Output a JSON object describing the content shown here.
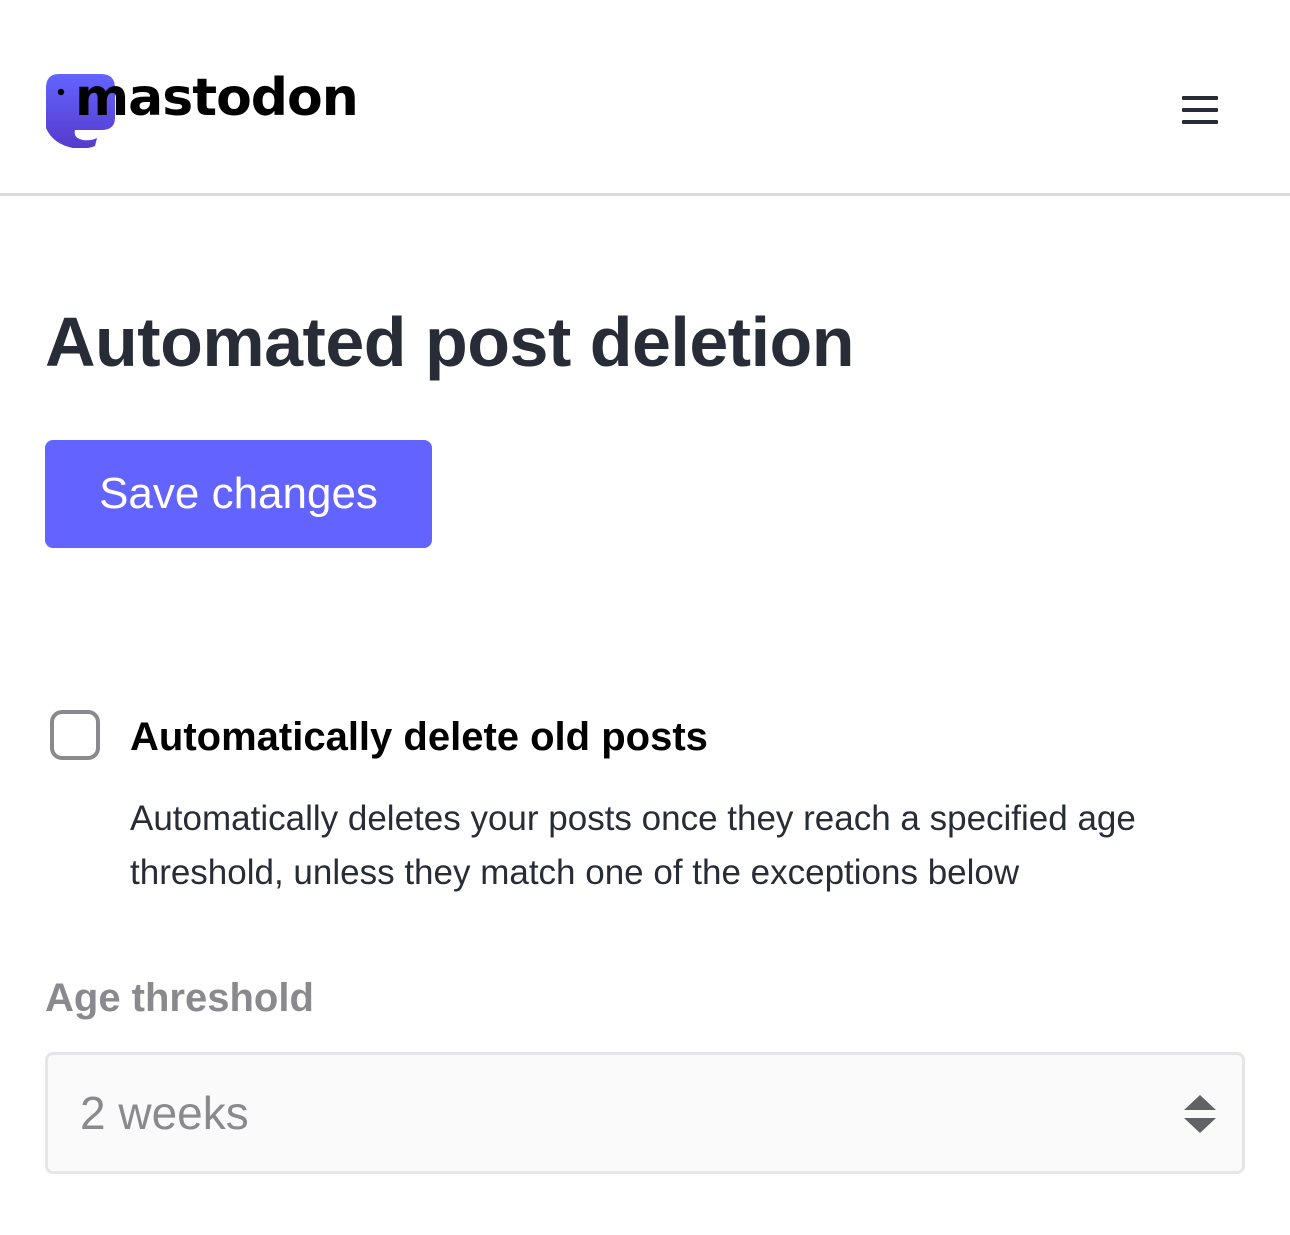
{
  "header": {
    "logo_text": "mastodon",
    "menu_icon": "hamburger-menu-icon",
    "brand_color": "#6364ff"
  },
  "main": {
    "title": "Automated post deletion",
    "save_button_label": "Save changes",
    "auto_delete": {
      "label": "Automatically delete old posts",
      "checked": false,
      "hint": "Automatically deletes your posts once they reach a specified age threshold, unless they match one of the exceptions below"
    },
    "age_threshold": {
      "label": "Age threshold",
      "selected_value": "2 weeks",
      "icon": "select-arrows-icon"
    }
  }
}
